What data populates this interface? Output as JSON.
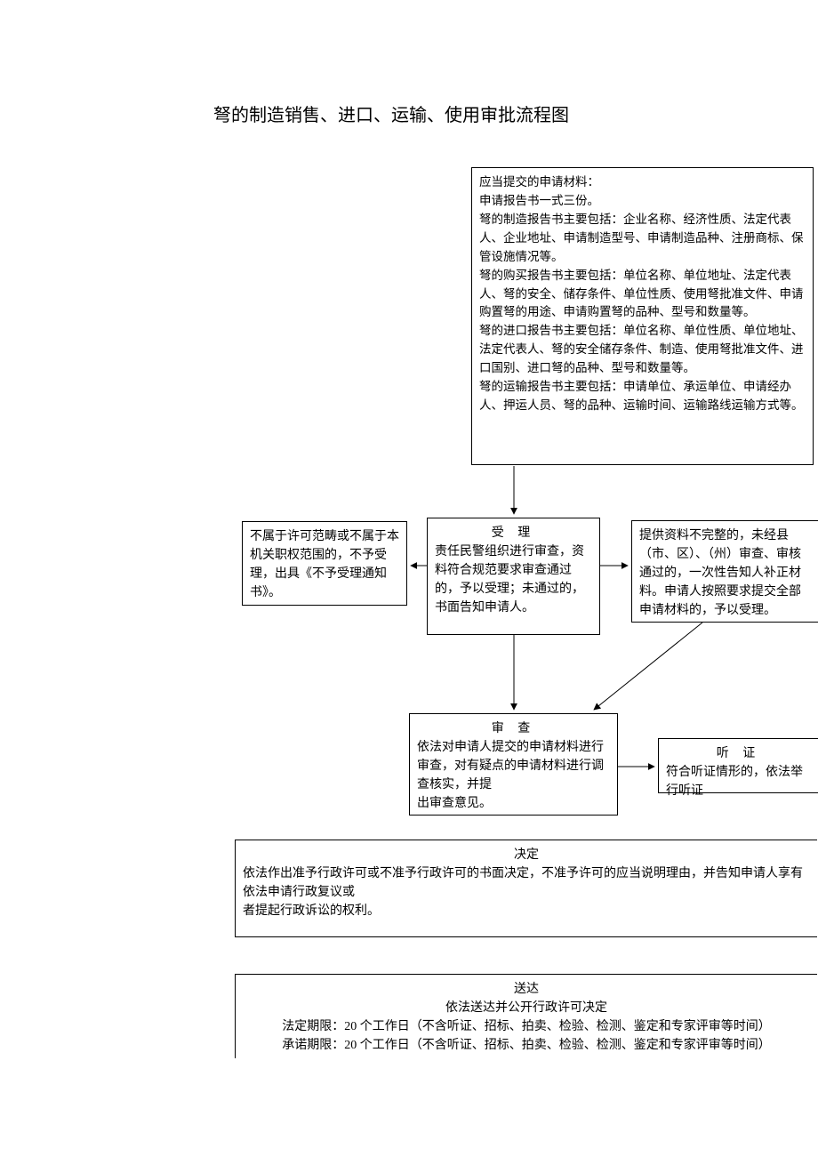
{
  "title": "弩的制造销售、进口、运输、使用审批流程图",
  "materials": {
    "l1": "应当提交的申请材料：",
    "l2": "申请报告书一式三份。",
    "l3": "弩的制造报告书主要包括：企业名称、经济性质、法定代表人、企业地址、申请制造型号、申请制造品种、注册商标、保管设施情况等。",
    "l4": "弩的购买报告书主要包括：单位名称、单位地址、法定代表人、弩的安全、储存条件、单位性质、使用弩批准文件、申请购置弩的用途、申请购置弩的品种、型号和数量等。",
    "l5": "弩的进口报告书主要包括：单位名称、单位性质、单位地址、法定代表人、弩的安全储存条件、制造、使用弩批准文件、进口国别、进口弩的品种、型号和数量等。",
    "l6": "弩的运输报告书主要包括：申请单位、承运单位、申请经办人、押运人员、弩的品种、运输时间、运输路线运输方式等。"
  },
  "reject": "不属于许可范畴或不属于本机关职权范围的，不予受理，出具《不予受理通知书》。",
  "accept": {
    "hdr": "受 理",
    "body": "责任民警组织进行审查，资料符合规范要求审查通过的，予以受理；未通过的，书面告知申请人。"
  },
  "incomplete": "提供资料不完整的，未经县（市、区）、（州）审查、审核通过的，一次性告知人补正材料。申请人按照要求提交全部申请材料的，予以受理。",
  "review": {
    "hdr": "审 查",
    "body1": "依法对申请人提交的申请材料进行审查，对有疑点的申请材料进行调查核实，并提",
    "body2": "出审查意见。"
  },
  "hearing": {
    "hdr": "听 证",
    "body": "符合听证情形的，依法举行听证"
  },
  "decision": {
    "hdr": "决定",
    "l1": "依法作出准予行政许可或不准予行政许可的书面决定，不准予许可的应当说明理由，并告知申请人享有依法申请行政复议或",
    "l2": "者提起行政诉讼的权利。"
  },
  "delivery": {
    "hdr": "送达",
    "l1": "依法送达并公开行政许可决定",
    "l2": "法定期限：20 个工作日（不含听证、招标、拍卖、检验、检测、鉴定和专家评审等时间）",
    "l3": "承诺期限：20 个工作日（不含听证、招标、拍卖、检验、检测、鉴定和专家评审等时间）"
  }
}
